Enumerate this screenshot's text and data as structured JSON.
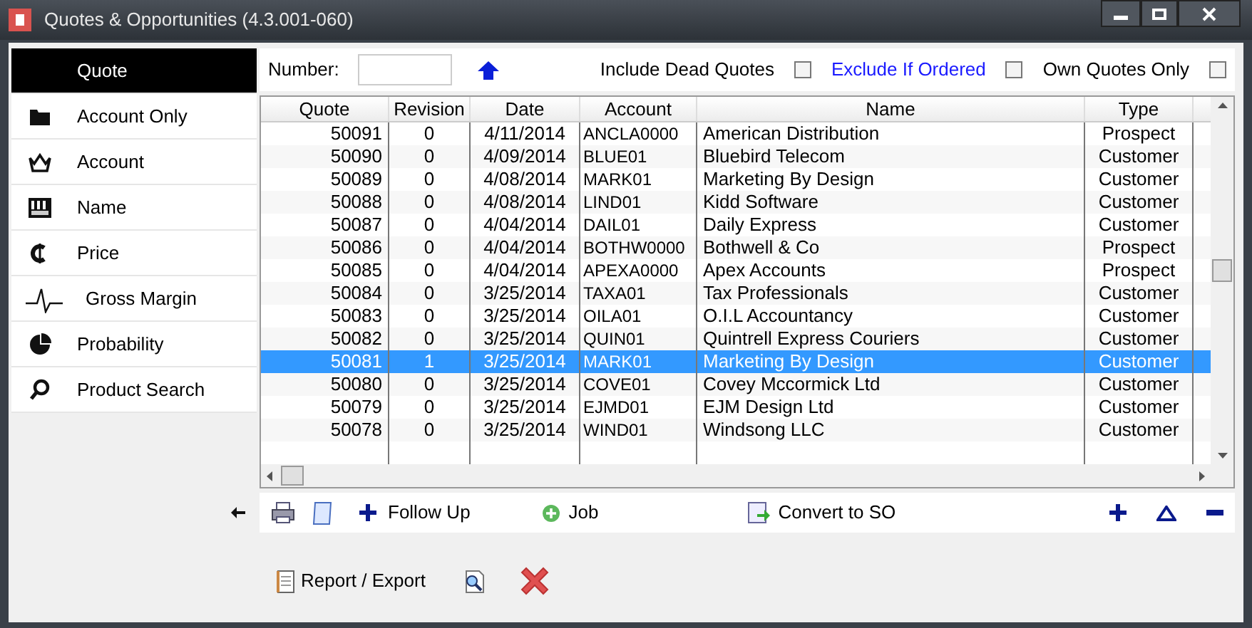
{
  "window": {
    "title": "Quotes & Opportunities (4.3.001-060)"
  },
  "sidebar": {
    "items": [
      {
        "label": "Quote",
        "selected": true
      },
      {
        "label": "Account Only",
        "selected": false
      },
      {
        "label": "Account",
        "selected": false
      },
      {
        "label": "Name",
        "selected": false
      },
      {
        "label": "Price",
        "selected": false
      },
      {
        "label": "Gross Margin",
        "selected": false
      },
      {
        "label": "Probability",
        "selected": false
      },
      {
        "label": "Product Search",
        "selected": false
      }
    ]
  },
  "filters": {
    "number_label": "Number:",
    "options": [
      {
        "label": "Include Dead Quotes",
        "kind": "plain",
        "checked": false
      },
      {
        "label": "Exclude If Ordered",
        "kind": "link",
        "checked": false
      },
      {
        "label": "Own Quotes Only",
        "kind": "plain",
        "checked": false
      }
    ]
  },
  "table": {
    "columns": [
      "Quote",
      "Revision",
      "Date",
      "Account",
      "Name",
      "Type"
    ],
    "rows": [
      {
        "cells": [
          "50091",
          "0",
          "4/11/2014",
          "ANCLA0000",
          "American Distribution",
          "Prospect"
        ],
        "selected": false
      },
      {
        "cells": [
          "50090",
          "0",
          "4/09/2014",
          "BLUE01",
          "Bluebird Telecom",
          "Customer"
        ],
        "selected": false
      },
      {
        "cells": [
          "50089",
          "0",
          "4/08/2014",
          "MARK01",
          "Marketing By Design",
          "Customer"
        ],
        "selected": false
      },
      {
        "cells": [
          "50088",
          "0",
          "4/08/2014",
          "LIND01",
          "Kidd Software",
          "Customer"
        ],
        "selected": false
      },
      {
        "cells": [
          "50087",
          "0",
          "4/04/2014",
          "DAIL01",
          "Daily Express",
          "Customer"
        ],
        "selected": false
      },
      {
        "cells": [
          "50086",
          "0",
          "4/04/2014",
          "BOTHW0000",
          "Bothwell & Co",
          "Prospect"
        ],
        "selected": false
      },
      {
        "cells": [
          "50085",
          "0",
          "4/04/2014",
          "APEXA0000",
          "Apex Accounts",
          "Prospect"
        ],
        "selected": false
      },
      {
        "cells": [
          "50084",
          "0",
          "3/25/2014",
          "TAXA01",
          "Tax Professionals",
          "Customer"
        ],
        "selected": false
      },
      {
        "cells": [
          "50083",
          "0",
          "3/25/2014",
          "OILA01",
          "O.I.L Accountancy",
          "Customer"
        ],
        "selected": false
      },
      {
        "cells": [
          "50082",
          "0",
          "3/25/2014",
          "QUIN01",
          "Quintrell Express Couriers",
          "Customer"
        ],
        "selected": false
      },
      {
        "cells": [
          "50081",
          "1",
          "3/25/2014",
          "MARK01",
          "Marketing By Design",
          "Customer"
        ],
        "selected": true
      },
      {
        "cells": [
          "50080",
          "0",
          "3/25/2014",
          "COVE01",
          "Covey Mccormick Ltd",
          "Customer"
        ],
        "selected": false
      },
      {
        "cells": [
          "50079",
          "0",
          "3/25/2014",
          "EJMD01",
          "EJM Design Ltd",
          "Customer"
        ],
        "selected": false
      },
      {
        "cells": [
          "50078",
          "0",
          "3/25/2014",
          "WIND01",
          "Windsong LLC",
          "Customer"
        ],
        "selected": false
      }
    ]
  },
  "toolbar": {
    "follow_up": "Follow Up",
    "job": "Job",
    "convert": "Convert to SO"
  },
  "footer": {
    "report": "Report / Export"
  }
}
